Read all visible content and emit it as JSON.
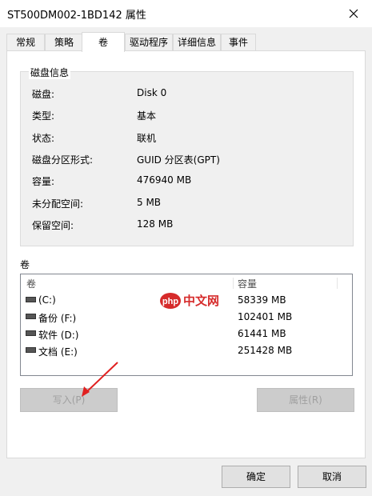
{
  "window": {
    "title": "ST500DM002-1BD142 属性"
  },
  "tabs": [
    {
      "label": "常规"
    },
    {
      "label": "策略"
    },
    {
      "label": "卷"
    },
    {
      "label": "驱动程序"
    },
    {
      "label": "详细信息"
    },
    {
      "label": "事件"
    }
  ],
  "active_tab": "卷",
  "disk_info": {
    "title": "磁盘信息",
    "rows": [
      {
        "label": "磁盘:",
        "value": "Disk 0"
      },
      {
        "label": "类型:",
        "value": "基本"
      },
      {
        "label": "状态:",
        "value": "联机"
      },
      {
        "label": "磁盘分区形式:",
        "value": "GUID 分区表(GPT)"
      },
      {
        "label": "容量:",
        "value": "476940 MB"
      },
      {
        "label": "未分配空间:",
        "value": "5 MB"
      },
      {
        "label": "保留空间:",
        "value": "128 MB"
      }
    ]
  },
  "volumes": {
    "label": "卷",
    "columns": [
      "卷",
      "容量"
    ],
    "rows": [
      {
        "name": "(C:)",
        "size": "58339 MB"
      },
      {
        "name": "备份 (F:)",
        "size": "102401 MB"
      },
      {
        "name": "软件 (D:)",
        "size": "61441 MB"
      },
      {
        "name": "文档 (E:)",
        "size": "251428 MB"
      }
    ]
  },
  "buttons": {
    "import": "写入(P)",
    "properties": "属性(R)",
    "ok": "确定",
    "cancel": "取消"
  },
  "watermark": "php 中文网",
  "colors": {
    "accent_arrow": "#e02020",
    "watermark_red": "#d62b2b"
  }
}
